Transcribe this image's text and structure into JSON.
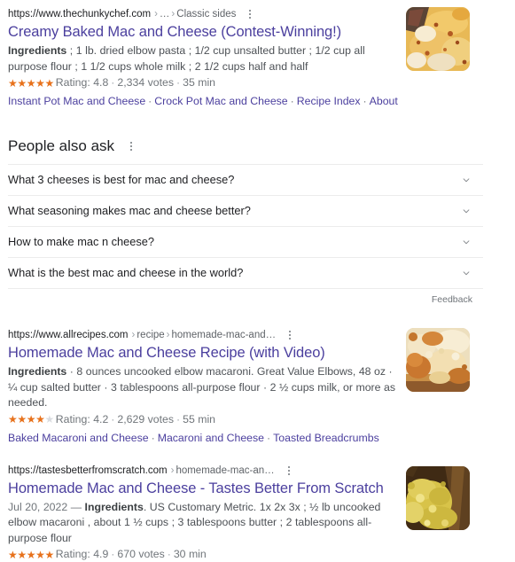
{
  "results": [
    {
      "url_domain": "https://www.thechunkychef.com",
      "url_crumbs_a": "…",
      "url_crumbs_b": "Classic sides",
      "title": "Creamy Baked Mac and Cheese (Contest-Winning!)",
      "snippet_bold": "Ingredients",
      "snippet_rest": " ; 1 lb. dried elbow pasta ; 1/2 cup unsalted butter ; 1/2 cup all purpose flour ; 1 1/2 cups whole milk ; 2 1/2 cups half and half",
      "rating_label": "Rating:",
      "rating_value": "4.8",
      "votes": "2,334 votes",
      "duration": "35 min",
      "stars_filled": 5,
      "stars_total": 5,
      "sitelinks": [
        "Instant Pot Mac and Cheese",
        "Crock Pot Mac and Cheese",
        "Recipe Index",
        "About"
      ],
      "thumb_alt": "baked-mac-and-cheese-thumbnail"
    },
    {
      "url_domain": "https://www.allrecipes.com",
      "url_crumbs_a": "recipe",
      "url_crumbs_b": "homemade-mac-and…",
      "title": "Homemade Mac and Cheese Recipe (with Video)",
      "snippet_bold": "Ingredients",
      "snippet_rest": " · 8 ounces uncooked elbow macaroni. Great Value Elbows, 48 oz · ¼ cup salted butter · 3 tablespoons all-purpose flour · 2 ½ cups milk, or more as needed.",
      "rating_label": "Rating:",
      "rating_value": "4.2",
      "votes": "2,629 votes",
      "duration": "55 min",
      "stars_filled": 4,
      "stars_total": 5,
      "sitelinks": [
        "Baked Macaroni and Cheese",
        "Macaroni and Cheese",
        "Toasted Breadcrumbs"
      ],
      "thumb_alt": "homemade-mac-and-cheese-thumbnail"
    },
    {
      "url_domain": "https://tastesbetterfromscratch.com",
      "url_crumbs_a": "homemade-mac-an…",
      "url_crumbs_b": "",
      "title": "Homemade Mac and Cheese - Tastes Better From Scratch",
      "snippet_date": "Jul 20, 2022 — ",
      "snippet_bold": "Ingredients",
      "snippet_rest": ". US Customary Metric. 1x 2x 3x ; ½ lb uncooked elbow macaroni , about 1 ½ cups ; 3 tablespoons butter ; 2 tablespoons all-purpose flour",
      "rating_label": "Rating:",
      "rating_value": "4.9",
      "votes": "670 votes",
      "duration": "30 min",
      "stars_filled": 5,
      "stars_total": 5,
      "sitelinks": [],
      "thumb_alt": "mac-and-cheese-pot-thumbnail"
    }
  ],
  "people_also_ask": {
    "heading": "People also ask",
    "questions": [
      "What 3 cheeses is best for mac and cheese?",
      "What seasoning makes mac and cheese better?",
      "How to make mac n cheese?",
      "What is the best mac and cheese in the world?"
    ],
    "feedback_label": "Feedback"
  },
  "separators": {
    "dot": "·",
    "arrow": "›"
  },
  "colors": {
    "link": "#4b3f9e",
    "snippet": "#4d5156",
    "url": "#202124",
    "muted": "#70757a",
    "star_on": "#e7711b",
    "star_off": "#dadce0",
    "rule": "#ececec"
  }
}
